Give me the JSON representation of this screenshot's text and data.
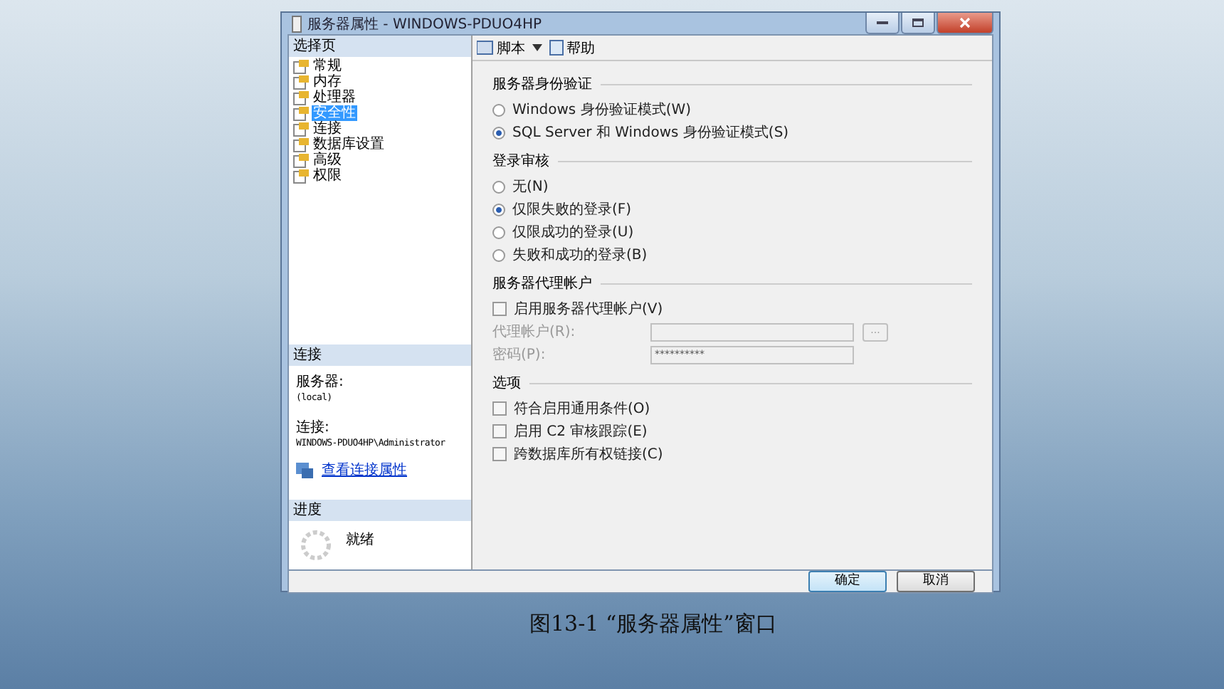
{
  "window": {
    "title": "服务器属性 - WINDOWS-PDUO4HP"
  },
  "sidebar": {
    "header": "选择页",
    "items": [
      {
        "label": "常规",
        "selected": false
      },
      {
        "label": "内存",
        "selected": false
      },
      {
        "label": "处理器",
        "selected": false
      },
      {
        "label": "安全性",
        "selected": true
      },
      {
        "label": "连接",
        "selected": false
      },
      {
        "label": "数据库设置",
        "selected": false
      },
      {
        "label": "高级",
        "selected": false
      },
      {
        "label": "权限",
        "selected": false
      }
    ]
  },
  "connection": {
    "header": "连接",
    "server_label": "服务器:",
    "server": "(local)",
    "connection_label": "连接:",
    "connection": "WINDOWS-PDUO4HP\\Administrator",
    "link": "查看连接属性"
  },
  "progress": {
    "header": "进度",
    "status": "就绪"
  },
  "toolbar": {
    "script": "脚本",
    "help": "帮助"
  },
  "sections": [
    {
      "kind": "radio",
      "title": "服务器身份验证",
      "items": [
        {
          "label": "Windows 身份验证模式(W)",
          "selected": false
        },
        {
          "label": "SQL Server 和 Windows 身份验证模式(S)",
          "selected": true
        }
      ]
    },
    {
      "kind": "radio",
      "title": "登录审核",
      "items": [
        {
          "label": "无(N)",
          "selected": false
        },
        {
          "label": "仅限失败的登录(F)",
          "selected": true
        },
        {
          "label": "仅限成功的登录(U)",
          "selected": false
        },
        {
          "label": "失败和成功的登录(B)",
          "selected": false
        }
      ]
    },
    {
      "kind": "proxy",
      "title": "服务器代理帐户",
      "items": [
        {
          "label": "启用服务器代理帐户(V)",
          "checked": false
        }
      ],
      "fields": [
        {
          "label": "代理帐户(R):",
          "browse": "..."
        },
        {
          "label": "密码(P):",
          "value": "**********"
        }
      ]
    },
    {
      "kind": "check",
      "title": "选项",
      "items": [
        {
          "label": "符合启用通用条件(O)",
          "checked": false
        },
        {
          "label": "启用 C2 审核跟踪(E)",
          "checked": false
        },
        {
          "label": "跨数据库所有权链接(C)",
          "checked": false
        }
      ]
    }
  ],
  "buttons": [
    {
      "label": "确定",
      "default": true
    },
    {
      "label": "取消",
      "default": false
    }
  ],
  "caption": "图13-1 “服务器属性”窗口"
}
